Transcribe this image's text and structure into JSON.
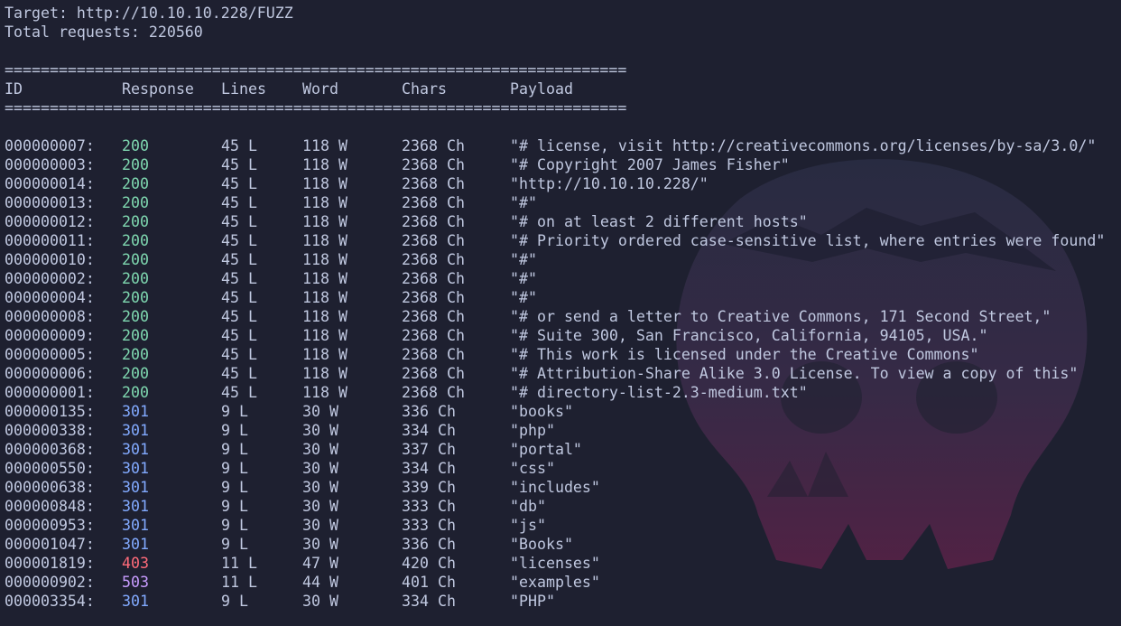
{
  "target_label": "Target: http://10.10.10.228/FUZZ",
  "total_label": "Total requests: 220560",
  "separator": "=====================================================================",
  "columns": {
    "id": "ID",
    "response": "Response",
    "lines": "Lines",
    "word": "Word",
    "chars": "Chars",
    "payload": "Payload"
  },
  "status_colors": {
    "200": "#7fd8b0",
    "301": "#82aaff",
    "403": "#ff6b7a",
    "503": "#c89cff"
  },
  "rows": [
    {
      "id": "000000007:",
      "response": "200",
      "lines": "45 L",
      "word": "118 W",
      "chars": "2368 Ch",
      "payload": "\"# license, visit http://creativecommons.org/licenses/by-sa/3.0/\""
    },
    {
      "id": "000000003:",
      "response": "200",
      "lines": "45 L",
      "word": "118 W",
      "chars": "2368 Ch",
      "payload": "\"# Copyright 2007 James Fisher\""
    },
    {
      "id": "000000014:",
      "response": "200",
      "lines": "45 L",
      "word": "118 W",
      "chars": "2368 Ch",
      "payload": "\"http://10.10.10.228/\""
    },
    {
      "id": "000000013:",
      "response": "200",
      "lines": "45 L",
      "word": "118 W",
      "chars": "2368 Ch",
      "payload": "\"#\""
    },
    {
      "id": "000000012:",
      "response": "200",
      "lines": "45 L",
      "word": "118 W",
      "chars": "2368 Ch",
      "payload": "\"# on at least 2 different hosts\""
    },
    {
      "id": "000000011:",
      "response": "200",
      "lines": "45 L",
      "word": "118 W",
      "chars": "2368 Ch",
      "payload": "\"# Priority ordered case-sensitive list, where entries were found\""
    },
    {
      "id": "000000010:",
      "response": "200",
      "lines": "45 L",
      "word": "118 W",
      "chars": "2368 Ch",
      "payload": "\"#\""
    },
    {
      "id": "000000002:",
      "response": "200",
      "lines": "45 L",
      "word": "118 W",
      "chars": "2368 Ch",
      "payload": "\"#\""
    },
    {
      "id": "000000004:",
      "response": "200",
      "lines": "45 L",
      "word": "118 W",
      "chars": "2368 Ch",
      "payload": "\"#\""
    },
    {
      "id": "000000008:",
      "response": "200",
      "lines": "45 L",
      "word": "118 W",
      "chars": "2368 Ch",
      "payload": "\"# or send a letter to Creative Commons, 171 Second Street,\""
    },
    {
      "id": "000000009:",
      "response": "200",
      "lines": "45 L",
      "word": "118 W",
      "chars": "2368 Ch",
      "payload": "\"# Suite 300, San Francisco, California, 94105, USA.\""
    },
    {
      "id": "000000005:",
      "response": "200",
      "lines": "45 L",
      "word": "118 W",
      "chars": "2368 Ch",
      "payload": "\"# This work is licensed under the Creative Commons\""
    },
    {
      "id": "000000006:",
      "response": "200",
      "lines": "45 L",
      "word": "118 W",
      "chars": "2368 Ch",
      "payload": "\"# Attribution-Share Alike 3.0 License. To view a copy of this\""
    },
    {
      "id": "000000001:",
      "response": "200",
      "lines": "45 L",
      "word": "118 W",
      "chars": "2368 Ch",
      "payload": "\"# directory-list-2.3-medium.txt\""
    },
    {
      "id": "000000135:",
      "response": "301",
      "lines": "9 L",
      "word": "30 W",
      "chars": "336 Ch",
      "payload": "\"books\""
    },
    {
      "id": "000000338:",
      "response": "301",
      "lines": "9 L",
      "word": "30 W",
      "chars": "334 Ch",
      "payload": "\"php\""
    },
    {
      "id": "000000368:",
      "response": "301",
      "lines": "9 L",
      "word": "30 W",
      "chars": "337 Ch",
      "payload": "\"portal\""
    },
    {
      "id": "000000550:",
      "response": "301",
      "lines": "9 L",
      "word": "30 W",
      "chars": "334 Ch",
      "payload": "\"css\""
    },
    {
      "id": "000000638:",
      "response": "301",
      "lines": "9 L",
      "word": "30 W",
      "chars": "339 Ch",
      "payload": "\"includes\""
    },
    {
      "id": "000000848:",
      "response": "301",
      "lines": "9 L",
      "word": "30 W",
      "chars": "333 Ch",
      "payload": "\"db\""
    },
    {
      "id": "000000953:",
      "response": "301",
      "lines": "9 L",
      "word": "30 W",
      "chars": "333 Ch",
      "payload": "\"js\""
    },
    {
      "id": "000001047:",
      "response": "301",
      "lines": "9 L",
      "word": "30 W",
      "chars": "336 Ch",
      "payload": "\"Books\""
    },
    {
      "id": "000001819:",
      "response": "403",
      "lines": "11 L",
      "word": "47 W",
      "chars": "420 Ch",
      "payload": "\"licenses\""
    },
    {
      "id": "000000902:",
      "response": "503",
      "lines": "11 L",
      "word": "44 W",
      "chars": "401 Ch",
      "payload": "\"examples\""
    },
    {
      "id": "000003354:",
      "response": "301",
      "lines": "9 L",
      "word": "30 W",
      "chars": "334 Ch",
      "payload": "\"PHP\""
    }
  ]
}
